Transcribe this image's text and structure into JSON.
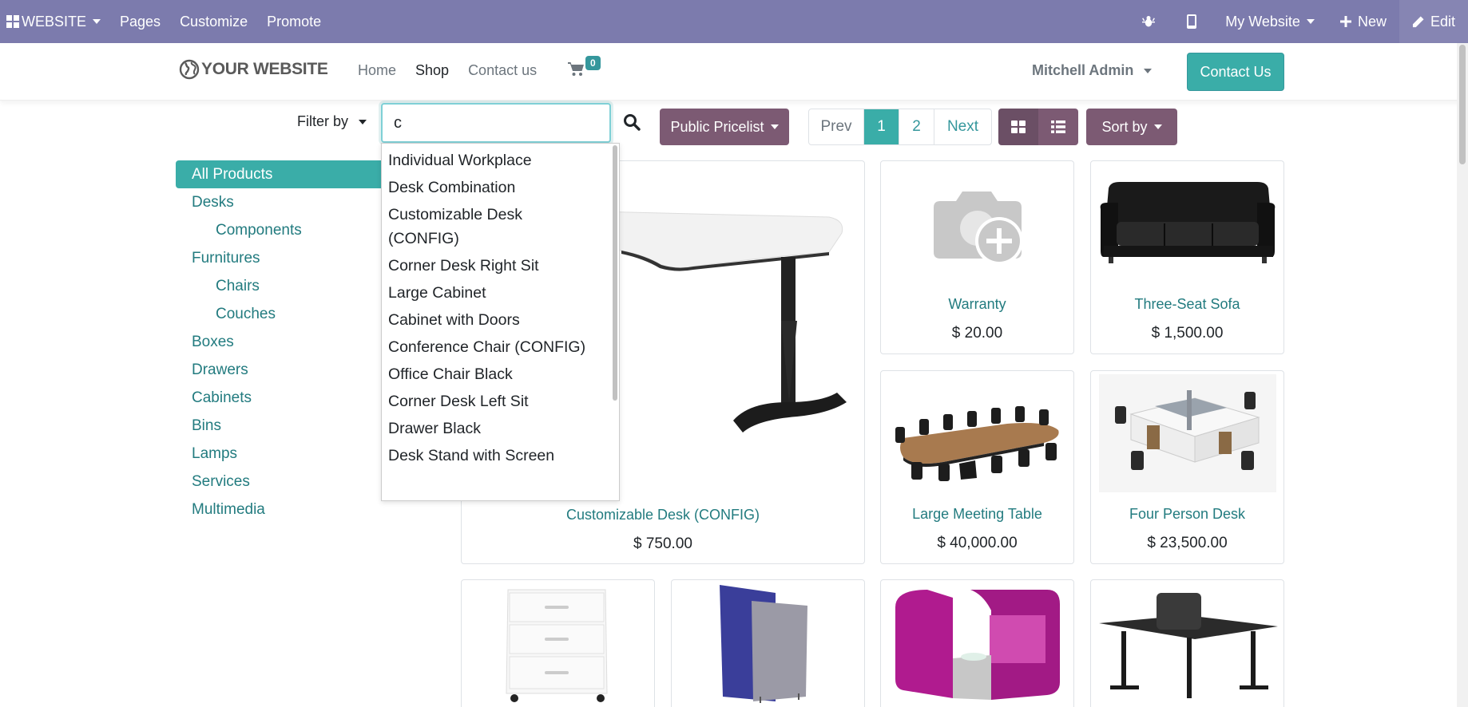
{
  "adminbar": {
    "apps_label": "WEBSITE",
    "menu": [
      "Pages",
      "Customize",
      "Promote"
    ],
    "website_selector": "My Website",
    "new_label": "New",
    "edit_label": "Edit"
  },
  "header": {
    "logo_text": "YOUR WEBSITE",
    "nav": [
      "Home",
      "Shop",
      "Contact us"
    ],
    "cart_count": "0",
    "user": "Mitchell Admin",
    "contact_button": "Contact Us"
  },
  "toolbar": {
    "filter_by": "Filter by",
    "search_value": "c",
    "pricelist": "Public Pricelist",
    "pager": {
      "prev": "Prev",
      "pages": [
        "1",
        "2"
      ],
      "current": "1",
      "next": "Next"
    },
    "sort_by": "Sort by"
  },
  "categories": [
    {
      "label": "All Products",
      "active": true,
      "sub": false
    },
    {
      "label": "Desks",
      "active": false,
      "sub": false
    },
    {
      "label": "Components",
      "active": false,
      "sub": true
    },
    {
      "label": "Furnitures",
      "active": false,
      "sub": false
    },
    {
      "label": "Chairs",
      "active": false,
      "sub": true
    },
    {
      "label": "Couches",
      "active": false,
      "sub": true
    },
    {
      "label": "Boxes",
      "active": false,
      "sub": false
    },
    {
      "label": "Drawers",
      "active": false,
      "sub": false
    },
    {
      "label": "Cabinets",
      "active": false,
      "sub": false
    },
    {
      "label": "Bins",
      "active": false,
      "sub": false
    },
    {
      "label": "Lamps",
      "active": false,
      "sub": false
    },
    {
      "label": "Services",
      "active": false,
      "sub": false
    },
    {
      "label": "Multimedia",
      "active": false,
      "sub": false
    }
  ],
  "autocomplete": [
    "Individual Workplace",
    "Desk Combination",
    "Customizable Desk (CONFIG)",
    "Corner Desk Right Sit",
    "Large Cabinet",
    "Cabinet with Doors",
    "Conference Chair (CONFIG)",
    "Office Chair Black",
    "Corner Desk Left Sit",
    "Drawer Black",
    "Desk Stand with Screen"
  ],
  "products": [
    {
      "name": "Customizable Desk (CONFIG)",
      "price": "$ 750.00"
    },
    {
      "name": "Warranty",
      "price": "$ 20.00"
    },
    {
      "name": "Three-Seat Sofa",
      "price": "$ 1,500.00"
    },
    {
      "name": "Large Meeting Table",
      "price": "$ 40,000.00"
    },
    {
      "name": "Four Person Desk",
      "price": "$ 23,500.00"
    }
  ],
  "colors": {
    "admin_bar": "#7c7bad",
    "primary": "#3aada8",
    "secondary": "#7c5a73",
    "link": "#227b7f"
  }
}
